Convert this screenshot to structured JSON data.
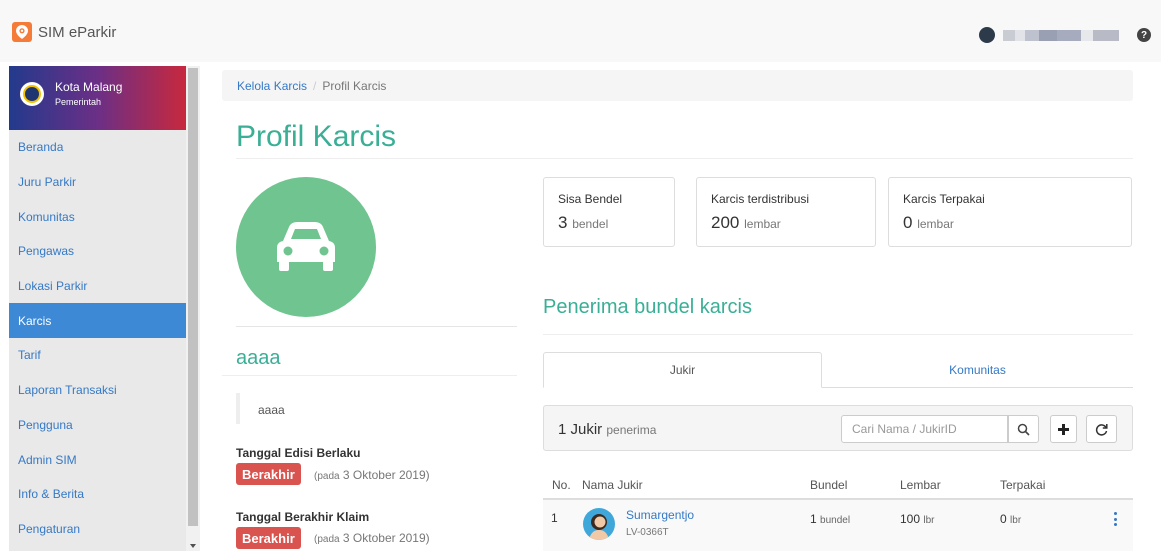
{
  "app": {
    "title": "SIM eParkir"
  },
  "sidebar": {
    "org_name": "Kota Malang",
    "org_sub": "Pemerintah",
    "items": [
      {
        "label": "Beranda"
      },
      {
        "label": "Juru Parkir"
      },
      {
        "label": "Komunitas"
      },
      {
        "label": "Pengawas"
      },
      {
        "label": "Lokasi Parkir"
      },
      {
        "label": "Karcis",
        "active": true
      },
      {
        "label": "Tarif"
      },
      {
        "label": "Laporan Transaksi"
      },
      {
        "label": "Pengguna"
      },
      {
        "label": "Admin SIM"
      },
      {
        "label": "Info & Berita"
      },
      {
        "label": "Pengaturan"
      }
    ]
  },
  "breadcrumb": {
    "parent": "Kelola Karcis",
    "separator": "/",
    "current": "Profil Karcis"
  },
  "page": {
    "title": "Profil Karcis"
  },
  "ticket": {
    "name": "aaaa",
    "description": "aaaa",
    "edition_label": "Tanggal Edisi Berlaku",
    "edition_badge": "Berakhir",
    "edition_note_prefix": "(pada",
    "edition_note_date": "3 Oktober 2019)",
    "claim_label": "Tanggal Berakhir Klaim",
    "claim_badge": "Berakhir",
    "claim_note_prefix": "(pada",
    "claim_note_date": "3 Oktober 2019)"
  },
  "stats": [
    {
      "label": "Sisa Bendel",
      "value": "3",
      "unit": "bendel"
    },
    {
      "label": "Karcis terdistribusi",
      "value": "200",
      "unit": "lembar"
    },
    {
      "label": "Karcis Terpakai",
      "value": "0",
      "unit": "lembar"
    }
  ],
  "recipients": {
    "title": "Penerima bundel karcis",
    "tabs": [
      {
        "label": "Jukir",
        "active": true
      },
      {
        "label": "Komunitas",
        "active": false
      }
    ],
    "count": "1 Jukir",
    "count_suffix": "penerima",
    "search_placeholder": "Cari Nama / JukirID",
    "columns": [
      "No.",
      "Nama Jukir",
      "Bundel",
      "Lembar",
      "Terpakai"
    ],
    "rows": [
      {
        "no": "1",
        "name": "Sumargentjo",
        "id": "LV-0366T",
        "bundel": "1",
        "bundel_unit": "bundel",
        "lembar": "100",
        "lembar_unit": "lbr",
        "terpakai": "0",
        "terpakai_unit": "lbr"
      }
    ]
  },
  "colors": {
    "accent": "#3aaf96",
    "link": "#3579c5",
    "active_nav": "#3d89d6",
    "danger": "#d9534f",
    "car_circle": "#6fc48f",
    "brand": "#f57c38"
  },
  "icons": [
    "location-pin-icon",
    "help-icon",
    "car-icon",
    "search-icon",
    "plus-icon",
    "refresh-icon",
    "kebab-icon"
  ]
}
